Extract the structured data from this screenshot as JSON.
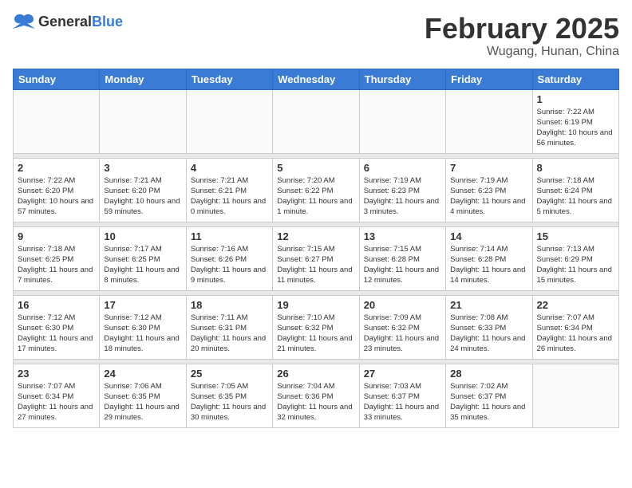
{
  "header": {
    "logo_general": "General",
    "logo_blue": "Blue",
    "month_title": "February 2025",
    "location": "Wugang, Hunan, China"
  },
  "weekdays": [
    "Sunday",
    "Monday",
    "Tuesday",
    "Wednesday",
    "Thursday",
    "Friday",
    "Saturday"
  ],
  "weeks": [
    [
      {
        "day": "",
        "info": ""
      },
      {
        "day": "",
        "info": ""
      },
      {
        "day": "",
        "info": ""
      },
      {
        "day": "",
        "info": ""
      },
      {
        "day": "",
        "info": ""
      },
      {
        "day": "",
        "info": ""
      },
      {
        "day": "1",
        "info": "Sunrise: 7:22 AM\nSunset: 6:19 PM\nDaylight: 10 hours and 56 minutes."
      }
    ],
    [
      {
        "day": "2",
        "info": "Sunrise: 7:22 AM\nSunset: 6:20 PM\nDaylight: 10 hours and 57 minutes."
      },
      {
        "day": "3",
        "info": "Sunrise: 7:21 AM\nSunset: 6:20 PM\nDaylight: 10 hours and 59 minutes."
      },
      {
        "day": "4",
        "info": "Sunrise: 7:21 AM\nSunset: 6:21 PM\nDaylight: 11 hours and 0 minutes."
      },
      {
        "day": "5",
        "info": "Sunrise: 7:20 AM\nSunset: 6:22 PM\nDaylight: 11 hours and 1 minute."
      },
      {
        "day": "6",
        "info": "Sunrise: 7:19 AM\nSunset: 6:23 PM\nDaylight: 11 hours and 3 minutes."
      },
      {
        "day": "7",
        "info": "Sunrise: 7:19 AM\nSunset: 6:23 PM\nDaylight: 11 hours and 4 minutes."
      },
      {
        "day": "8",
        "info": "Sunrise: 7:18 AM\nSunset: 6:24 PM\nDaylight: 11 hours and 5 minutes."
      }
    ],
    [
      {
        "day": "9",
        "info": "Sunrise: 7:18 AM\nSunset: 6:25 PM\nDaylight: 11 hours and 7 minutes."
      },
      {
        "day": "10",
        "info": "Sunrise: 7:17 AM\nSunset: 6:25 PM\nDaylight: 11 hours and 8 minutes."
      },
      {
        "day": "11",
        "info": "Sunrise: 7:16 AM\nSunset: 6:26 PM\nDaylight: 11 hours and 9 minutes."
      },
      {
        "day": "12",
        "info": "Sunrise: 7:15 AM\nSunset: 6:27 PM\nDaylight: 11 hours and 11 minutes."
      },
      {
        "day": "13",
        "info": "Sunrise: 7:15 AM\nSunset: 6:28 PM\nDaylight: 11 hours and 12 minutes."
      },
      {
        "day": "14",
        "info": "Sunrise: 7:14 AM\nSunset: 6:28 PM\nDaylight: 11 hours and 14 minutes."
      },
      {
        "day": "15",
        "info": "Sunrise: 7:13 AM\nSunset: 6:29 PM\nDaylight: 11 hours and 15 minutes."
      }
    ],
    [
      {
        "day": "16",
        "info": "Sunrise: 7:12 AM\nSunset: 6:30 PM\nDaylight: 11 hours and 17 minutes."
      },
      {
        "day": "17",
        "info": "Sunrise: 7:12 AM\nSunset: 6:30 PM\nDaylight: 11 hours and 18 minutes."
      },
      {
        "day": "18",
        "info": "Sunrise: 7:11 AM\nSunset: 6:31 PM\nDaylight: 11 hours and 20 minutes."
      },
      {
        "day": "19",
        "info": "Sunrise: 7:10 AM\nSunset: 6:32 PM\nDaylight: 11 hours and 21 minutes."
      },
      {
        "day": "20",
        "info": "Sunrise: 7:09 AM\nSunset: 6:32 PM\nDaylight: 11 hours and 23 minutes."
      },
      {
        "day": "21",
        "info": "Sunrise: 7:08 AM\nSunset: 6:33 PM\nDaylight: 11 hours and 24 minutes."
      },
      {
        "day": "22",
        "info": "Sunrise: 7:07 AM\nSunset: 6:34 PM\nDaylight: 11 hours and 26 minutes."
      }
    ],
    [
      {
        "day": "23",
        "info": "Sunrise: 7:07 AM\nSunset: 6:34 PM\nDaylight: 11 hours and 27 minutes."
      },
      {
        "day": "24",
        "info": "Sunrise: 7:06 AM\nSunset: 6:35 PM\nDaylight: 11 hours and 29 minutes."
      },
      {
        "day": "25",
        "info": "Sunrise: 7:05 AM\nSunset: 6:35 PM\nDaylight: 11 hours and 30 minutes."
      },
      {
        "day": "26",
        "info": "Sunrise: 7:04 AM\nSunset: 6:36 PM\nDaylight: 11 hours and 32 minutes."
      },
      {
        "day": "27",
        "info": "Sunrise: 7:03 AM\nSunset: 6:37 PM\nDaylight: 11 hours and 33 minutes."
      },
      {
        "day": "28",
        "info": "Sunrise: 7:02 AM\nSunset: 6:37 PM\nDaylight: 11 hours and 35 minutes."
      },
      {
        "day": "",
        "info": ""
      }
    ]
  ]
}
